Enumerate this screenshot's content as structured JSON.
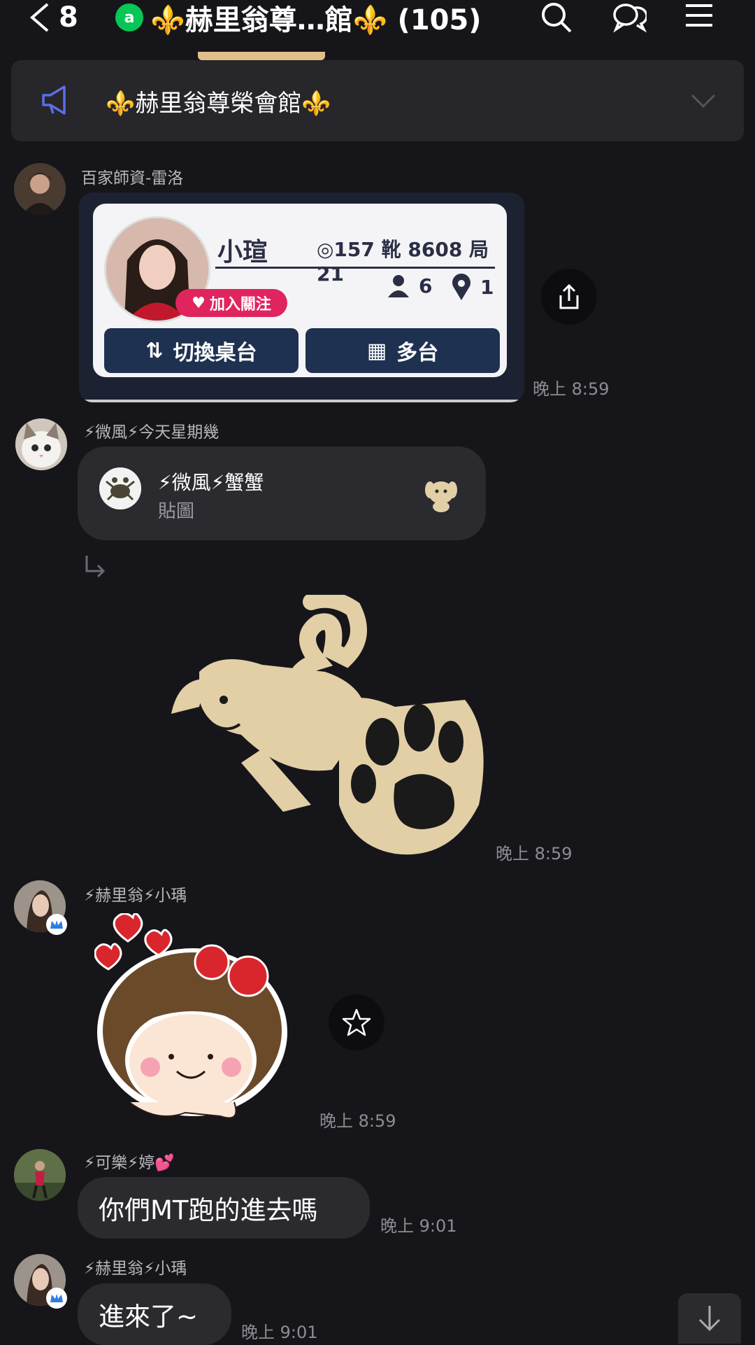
{
  "header": {
    "back_count": "8",
    "oa_badge": "a",
    "title": "⚜️赫里翁尊…館⚜️ (105)"
  },
  "announcement": {
    "text": "⚜️赫里翁尊榮會館⚜️"
  },
  "messages": [
    {
      "sender": "百家師資-雷洛",
      "type": "card",
      "card": {
        "name": "小瑄",
        "id_line": "◎157 靴 8608 局 21",
        "follow_label": "加入關注",
        "count_people": "6",
        "count_location": "1",
        "btn_switch": "切換桌台",
        "btn_multi": "多台"
      },
      "time": "晚上 8:59"
    },
    {
      "sender": "⚡微風⚡今天星期幾",
      "type": "reply_sticker",
      "reply": {
        "name": "⚡微風⚡蟹蟹",
        "sub": "貼圖"
      },
      "time": "晚上 8:59"
    },
    {
      "sender": "⚡赫里翁⚡小瑀",
      "type": "sticker",
      "time": "晚上 8:59"
    },
    {
      "sender": "⚡可樂⚡婷💕",
      "type": "text",
      "text": "你們MT跑的進去嗎",
      "time": "晚上 9:01"
    },
    {
      "sender": "⚡赫里翁⚡小瑀",
      "type": "text",
      "text": "進來了~",
      "time": "晚上 9:01"
    }
  ],
  "colors": {
    "background": "#16161a",
    "bubble": "#2a2a2f",
    "line_green": "#06c755",
    "accent_blue": "#4a5bd6"
  }
}
